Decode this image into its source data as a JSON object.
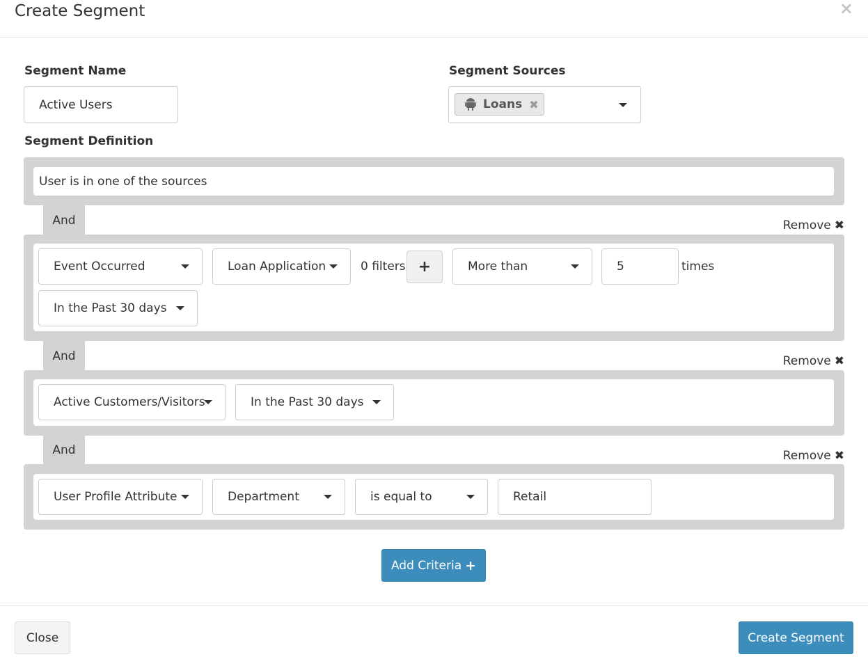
{
  "header": {
    "title": "Create Segment",
    "close_glyph": "×"
  },
  "form": {
    "segment_name_label": "Segment Name",
    "segment_name_value": "Active Users",
    "segment_sources_label": "Segment Sources",
    "source_tag": "Loans",
    "source_tag_icon": "android-icon",
    "tag_remove_glyph": "✖",
    "segment_definition_label": "Segment Definition"
  },
  "definition": {
    "base_text": "User is in one of the sources",
    "and_label": "And",
    "remove_label": "Remove",
    "remove_glyph": "✖",
    "criteria": [
      {
        "type": "Event Occurred",
        "event": "Loan Application",
        "filters": "0 filters",
        "add_filter_glyph": "+",
        "comparison": "More than",
        "count": "5",
        "unit": "times",
        "period": "In the Past 30 days"
      },
      {
        "type": "Active Customers/Visitors",
        "period": "In the Past 30 days"
      },
      {
        "type": "User Profile Attribute",
        "attribute": "Department",
        "operator": "is equal to",
        "value": "Retail"
      }
    ]
  },
  "actions": {
    "add_criteria_label": "Add Criteria",
    "add_criteria_glyph": "+",
    "close_label": "Close",
    "create_label": "Create Segment"
  },
  "colors": {
    "primary": "#3c8dbc",
    "block_gray": "#d3d3d3",
    "border": "#cccccc"
  }
}
